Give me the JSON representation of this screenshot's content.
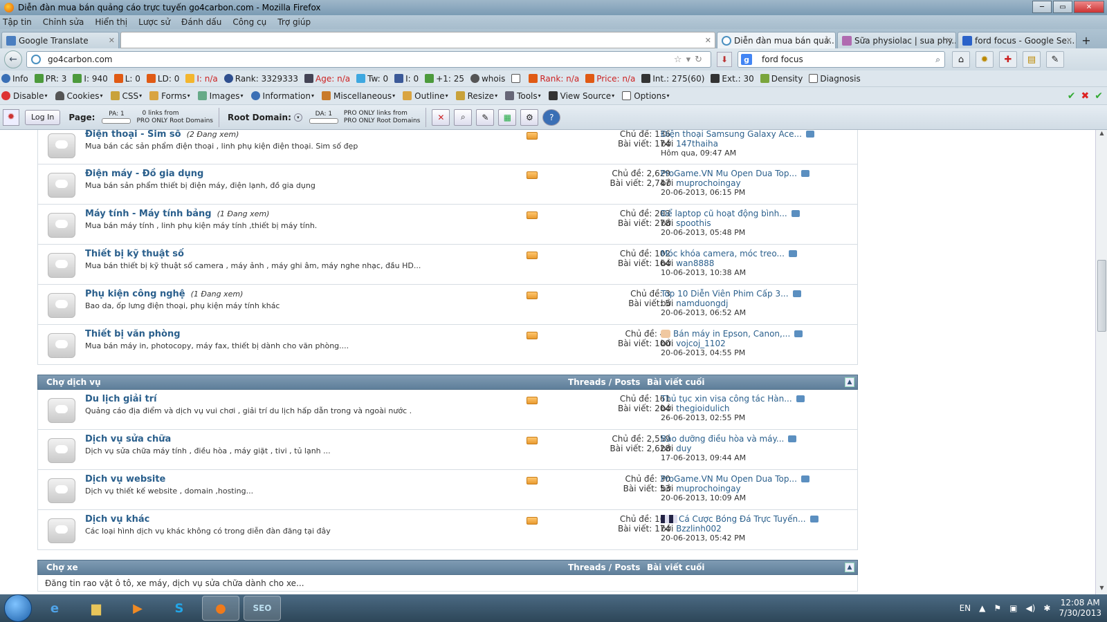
{
  "window": {
    "title": "Diễn đàn mua bán quảng cáo trực tuyến go4carbon.com - Mozilla Firefox"
  },
  "menu": [
    "Tập tin",
    "Chỉnh sửa",
    "Hiển thị",
    "Lược sử",
    "Đánh dấu",
    "Công cụ",
    "Trợ giúp"
  ],
  "tabs": [
    {
      "label": "Google Translate"
    },
    {
      "label": ""
    },
    {
      "label": "Diễn đàn mua bán quả..."
    },
    {
      "label": "Sữa physiolac | sua phy..."
    },
    {
      "label": "ford focus - Google Se..."
    }
  ],
  "nav": {
    "url": "go4carbon.com",
    "search": "ford focus"
  },
  "seobar": [
    "Info",
    "PR: 3",
    "I: 940",
    "L: 0",
    "LD: 0",
    "I: n/a",
    "Rank: 3329333",
    "Age: n/a",
    "Tw: 0",
    "I: 0",
    "+1: 25",
    "whois",
    "",
    "Rank: n/a",
    "Price: n/a",
    "Int.: 275(60)",
    "Ext.: 30",
    "Density",
    "Diagnosis"
  ],
  "devbar": [
    "Disable",
    "Cookies",
    "CSS",
    "Forms",
    "Images",
    "Information",
    "Miscellaneous",
    "Outline",
    "Resize",
    "Tools",
    "View Source",
    "Options"
  ],
  "mozbar": {
    "login": "Log In",
    "page_label": "Page:",
    "pa": "PA: 1",
    "page_links_1": "0 links from",
    "page_links_2": "PRO ONLY Root Domains",
    "root_label": "Root Domain:",
    "da": "DA: 1",
    "root_links_1": "PRO ONLY links from",
    "root_links_2": "PRO ONLY Root Domains"
  },
  "forums_top": [
    {
      "title": "Điện thoại - Sim số",
      "viewing": "(2 Đang xem)",
      "desc": "Mua bán các sản phẩm điện thoại , linh phụ kiện điện thoại. Sim số đẹp",
      "threads": "Chủ đề: 136",
      "posts": "Bài viết: 174",
      "last_title": "Điện thoại Samsung Galaxy Ace...",
      "last_by": "bởi",
      "last_user": "147thaiha",
      "last_date": "Hôm qua, 09:47 AM"
    },
    {
      "title": "Điện máy - Đồ gia dụng",
      "viewing": "",
      "desc": "Mua bán sản phẩm thiết bị điện máy, điện lạnh, đồ gia dụng",
      "threads": "Chủ đề: 2,629",
      "posts": "Bài viết: 2,747",
      "last_title": "ProGame.VN Mu Open Dua Top...",
      "last_by": "bởi",
      "last_user": "muprochoingay",
      "last_date": "20-06-2013, 06:15 PM"
    },
    {
      "title": "Máy tính - Máy tính bảng",
      "viewing": "(1 Đang xem)",
      "desc": "Mua bán máy tính , linh phụ kiện máy tính ,thiết bị máy tính.",
      "threads": "Chủ đề: 203",
      "posts": "Bài viết: 278",
      "last_title": "Để laptop cũ hoạt động bình...",
      "last_by": "bởi",
      "last_user": "spoothis",
      "last_date": "20-06-2013, 05:48 PM"
    },
    {
      "title": "Thiết bị kỹ thuật số",
      "viewing": "",
      "desc": "Mua bán thiết bị kỹ thuật số camera , máy ảnh , máy ghi âm, máy nghe nhạc, đầu HD...",
      "threads": "Chủ đề: 102",
      "posts": "Bài viết: 164",
      "last_title": "Móc khóa camera, móc treo...",
      "last_by": "bởi",
      "last_user": "wan8888",
      "last_date": "10-06-2013, 10:38 AM"
    },
    {
      "title": "Phụ kiện công nghệ",
      "viewing": "(1 Đang xem)",
      "desc": "Bao da, ốp lưng điện thoại, phụ kiện máy tính khác",
      "threads": "Chủ đề: 3",
      "posts": "Bài viết: 5",
      "last_title": "Top 10 Diễn Viên Phim Cấp 3...",
      "last_by": "bởi",
      "last_user": "namduongdj",
      "last_date": "20-06-2013, 06:52 AM"
    },
    {
      "title": "Thiết bị văn phòng",
      "viewing": "",
      "desc": "Mua bán máy in, photocopy, máy fax, thiết bị dành cho văn phòng....",
      "threads": "Chủ đề: 45",
      "posts": "Bài viết: 100",
      "last_title": "Bán máy in Epson, Canon,...",
      "last_by": "bởi",
      "last_user": "vojcoj_1102",
      "last_date": "20-06-2013, 04:55 PM"
    }
  ],
  "cat_service": {
    "name": "Chợ dịch vụ",
    "threads_posts": "Threads / Posts",
    "last_post": "Bài viết cuối"
  },
  "forums_service": [
    {
      "title": "Du lịch giải trí",
      "viewing": "",
      "desc": "Quảng cáo địa điểm và dịch vụ vui chơi , giải trí du lịch hấp dẫn trong và ngoài nước .",
      "threads": "Chủ đề: 161",
      "posts": "Bài viết: 204",
      "last_title": "Thủ tục xin visa công tác Hàn...",
      "last_by": "bởi",
      "last_user": "thegioidulich",
      "last_date": "26-06-2013, 02:55 PM"
    },
    {
      "title": "Dịch vụ sửa chữa",
      "viewing": "",
      "desc": "Dịch vụ sửa chữa máy tính , điều hòa , máy giặt , tivi , tủ lạnh ...",
      "threads": "Chủ đề: 2,559",
      "posts": "Bài viết: 2,628",
      "last_title": "Bảo dưỡng điều hòa và máy...",
      "last_by": "bởi",
      "last_user": "duy",
      "last_date": "17-06-2013, 09:44 AM"
    },
    {
      "title": "Dịch vụ website",
      "viewing": "",
      "desc": "Dịch vụ thiết kế website , domain ,hosting...",
      "threads": "Chủ đề: 30",
      "posts": "Bài viết: 53",
      "last_title": "ProGame.VN Mu Open Dua Top...",
      "last_by": "bởi",
      "last_user": "muprochoingay",
      "last_date": "20-06-2013, 10:09 AM"
    },
    {
      "title": "Dịch vụ khác",
      "viewing": "",
      "desc": "Các loại hình dịch vụ khác không có trong diễn đàn đăng tại đây",
      "threads": "Chủ đề: 165",
      "posts": "Bài viết: 174",
      "last_title": "Cá Cược Bóng Đá Trực Tuyến...",
      "last_by": "bởi",
      "last_user": "Bzzlinh002",
      "last_date": "20-06-2013, 05:42 PM"
    }
  ],
  "cat_car": {
    "name": "Chợ xe",
    "threads_posts": "Threads / Posts",
    "last_post": "Bài viết cuối",
    "desc": "Đăng tin rao vặt ô tô, xe máy, dịch vụ sửa chữa dành cho xe..."
  },
  "taskbar": {
    "lang": "EN",
    "time": "12:08 AM",
    "date": "7/30/2013"
  }
}
